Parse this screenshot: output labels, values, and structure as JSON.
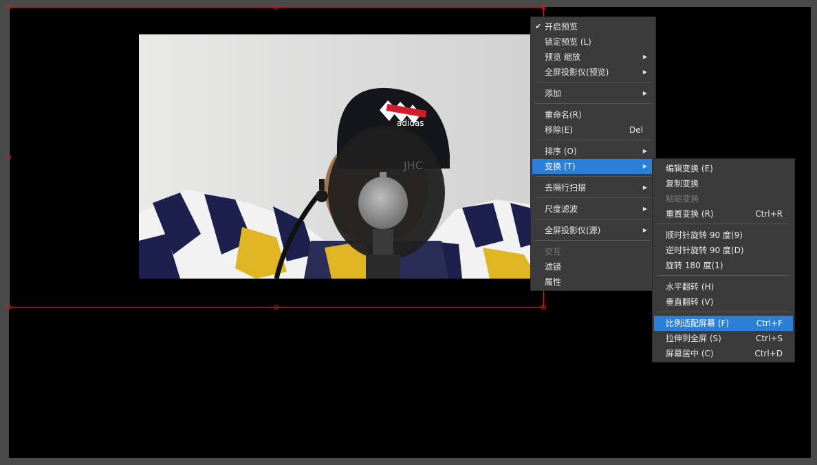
{
  "colors": {
    "outer_bg": "#4a4a4a",
    "canvas_bg": "#000000",
    "selection": "#d12020",
    "menu_bg": "#3b3b3b",
    "highlight": "#2b7fd9",
    "disabled_text": "#7d7d7d"
  },
  "source_image": {
    "description_icon": "image-source",
    "cap_logo_text": [
      "SOCIETY",
      "MENTALITY",
      "adidas"
    ],
    "screen_text": "JHC"
  },
  "main_menu": {
    "items": [
      {
        "label": "开启预览",
        "checked": true
      },
      {
        "label": "锁定预览 (L)"
      },
      {
        "label": "预览  缩放",
        "submenu": true
      },
      {
        "label": "全屏投影仪(预览)",
        "submenu": true
      },
      {
        "label": "添加",
        "submenu": true
      },
      {
        "label": "重命名(R)"
      },
      {
        "label": "移除(E)",
        "shortcut": "Del"
      },
      {
        "label": "排序 (O)",
        "submenu": true
      },
      {
        "label": "变换 (T)",
        "submenu": true,
        "active": true
      },
      {
        "label": "去隔行扫描",
        "submenu": true
      },
      {
        "label": "尺度滤波",
        "submenu": true
      },
      {
        "label": "全屏投影仪(源)",
        "submenu": true
      },
      {
        "label": "交互",
        "disabled": true
      },
      {
        "label": "滤镜"
      },
      {
        "label": "属性"
      }
    ],
    "check_glyph": "✔",
    "arrow_glyph": "▶"
  },
  "sub_menu": {
    "items": [
      {
        "label": "编辑变换 (E)"
      },
      {
        "label": "复制变换"
      },
      {
        "label": "粘贴变换",
        "disabled": true
      },
      {
        "label": "重置变换 (R)",
        "shortcut": "Ctrl+R"
      },
      {
        "label": "顺时针旋转 90 度(9)"
      },
      {
        "label": "逆时针旋转 90 度(D)"
      },
      {
        "label": "旋转 180 度(1)"
      },
      {
        "label": "水平翻转 (H)"
      },
      {
        "label": "垂直翻转 (V)"
      },
      {
        "label": "比例适配屏幕 (F)",
        "shortcut": "Ctrl+F",
        "active": true
      },
      {
        "label": "拉伸到全屏 (S)",
        "shortcut": "Ctrl+S"
      },
      {
        "label": "屏幕居中 (C)",
        "shortcut": "Ctrl+D"
      }
    ]
  }
}
